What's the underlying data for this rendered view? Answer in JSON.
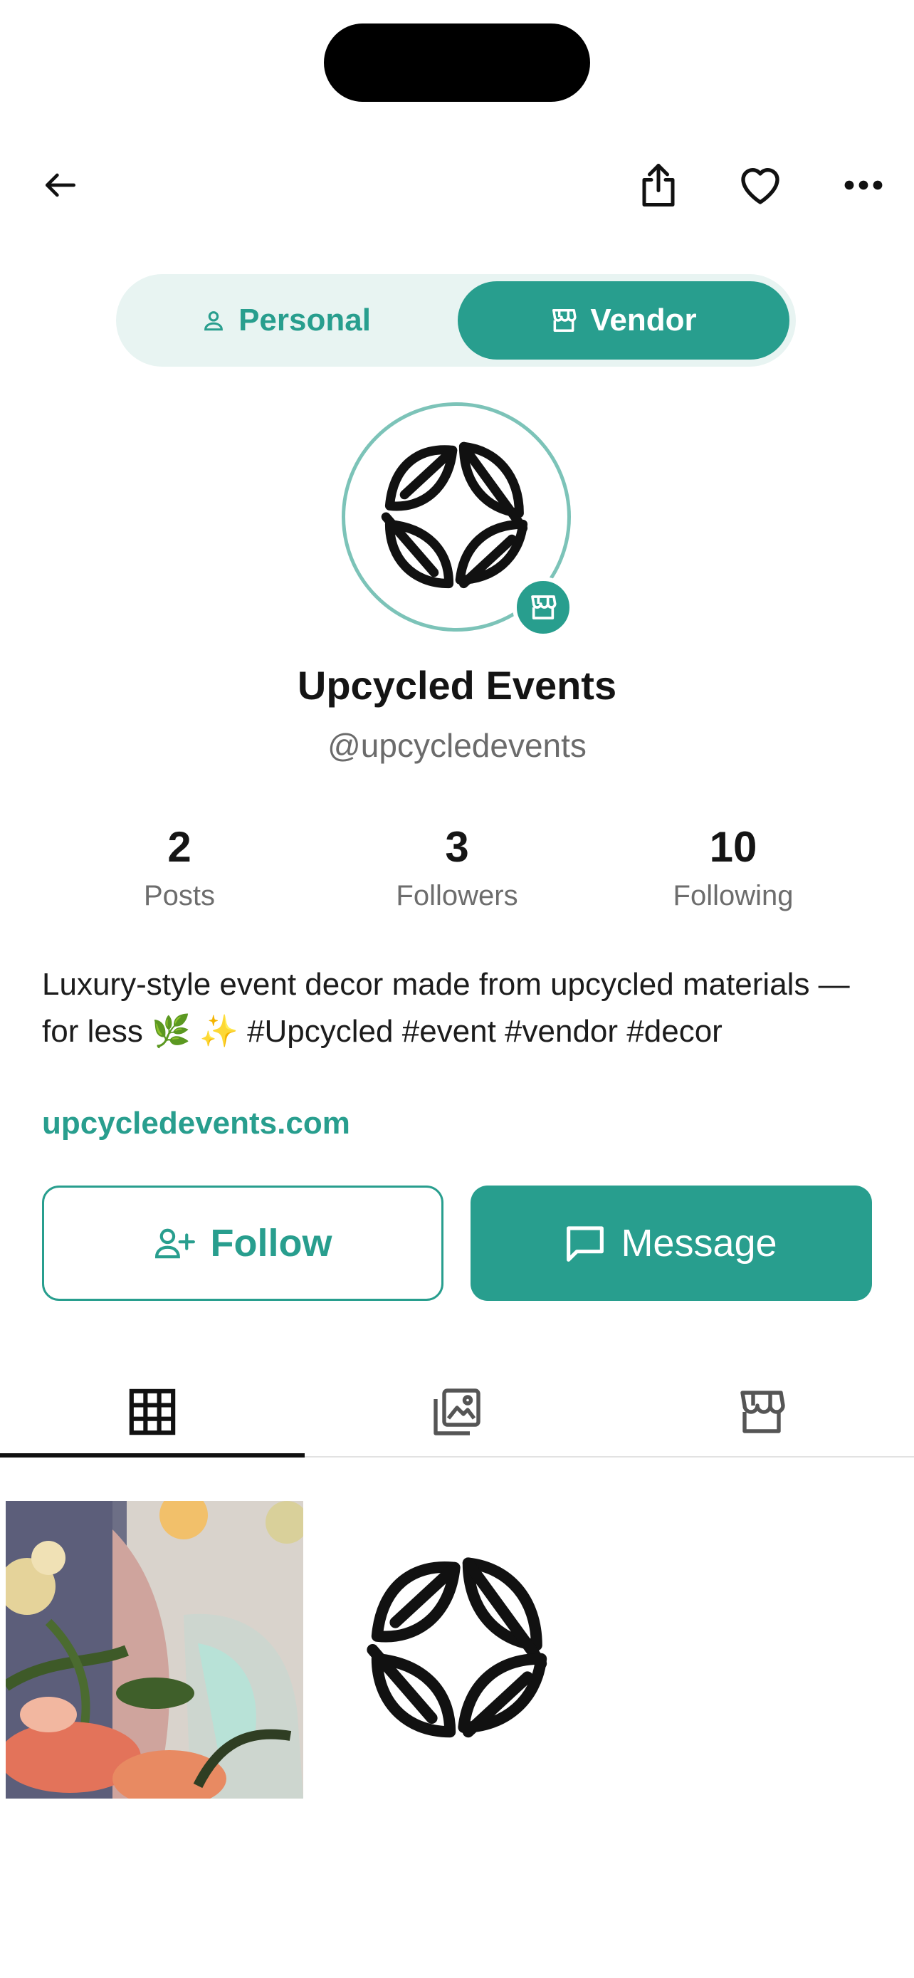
{
  "header": {
    "back_icon": "arrow-left-icon",
    "share_icon": "share-icon",
    "favorite_icon": "heart-icon",
    "more_icon": "more-horizontal-icon"
  },
  "segmented": {
    "personal_label": "Personal",
    "vendor_label": "Vendor",
    "selected": "Vendor"
  },
  "profile": {
    "name": "Upcycled Events",
    "handle": "@upcycledevents",
    "bio": "Luxury-style event decor made from upcycled materials — for less 🌿 ✨  #Upcycled #event #vendor #decor",
    "website": "upcycledevents.com"
  },
  "stats": [
    {
      "value": "2",
      "label": "Posts"
    },
    {
      "value": "3",
      "label": "Followers"
    },
    {
      "value": "10",
      "label": "Following"
    }
  ],
  "actions": {
    "follow_label": "Follow",
    "message_label": "Message"
  },
  "tabs": [
    {
      "icon": "grid-icon",
      "active": true
    },
    {
      "icon": "gallery-icon",
      "active": false
    },
    {
      "icon": "store-icon",
      "active": false
    }
  ],
  "colors": {
    "accent": "#289e8e",
    "accent_light": "#e8f4f2"
  }
}
